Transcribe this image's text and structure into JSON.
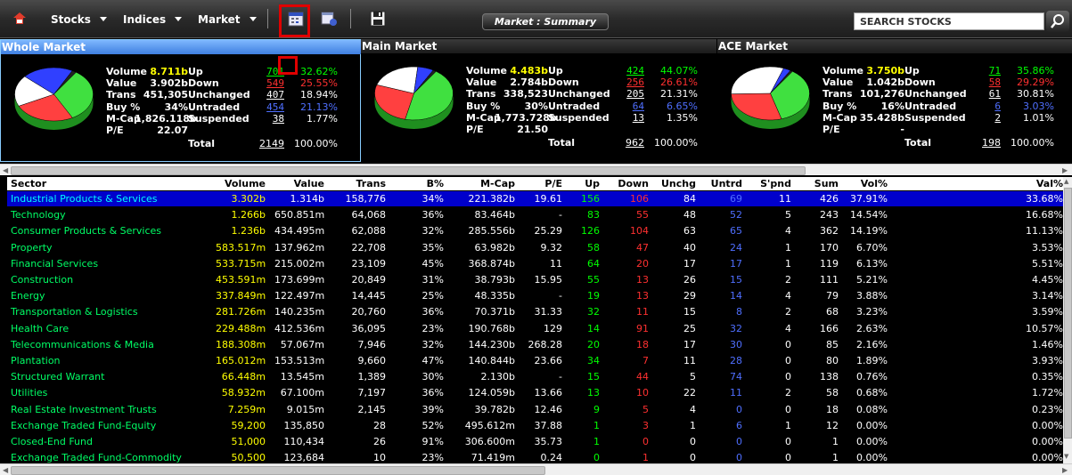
{
  "toolbar": {
    "menus": [
      {
        "label": "Stocks"
      },
      {
        "label": "Indices"
      },
      {
        "label": "Market"
      }
    ],
    "summary_label": "Market : Summary",
    "search_placeholder": "SEARCH STOCKS"
  },
  "panels": [
    {
      "title": "Whole Market",
      "title_color": "#5fa0ff",
      "labels": [
        "Volume",
        "Value",
        "Trans",
        "Buy %",
        "M-Cap",
        "P/E"
      ],
      "values": [
        "8.711b",
        "3.902b",
        "451,305",
        "34%",
        "1,826.118b",
        "22.07"
      ],
      "counts": [
        {
          "label": "Up",
          "count": "701",
          "pct": "32.62%"
        },
        {
          "label": "Down",
          "count": "549",
          "pct": "25.55%"
        },
        {
          "label": "Unchanged",
          "count": "407",
          "pct": "18.94%"
        },
        {
          "label": "Untraded",
          "count": "454",
          "pct": "21.13%"
        },
        {
          "label": "Suspended",
          "count": "38",
          "pct": "1.77%"
        }
      ],
      "total_label": "Total",
      "total_count": "2149",
      "total_pct": "100.00%",
      "pie": [
        32.62,
        25.55,
        18.94,
        21.13,
        1.77
      ]
    },
    {
      "title": "Main Market",
      "title_color": "#2a2a2a",
      "labels": [
        "Volume",
        "Value",
        "Trans",
        "Buy %",
        "M-Cap",
        "P/E"
      ],
      "values": [
        "4.483b",
        "2.784b",
        "338,523",
        "30%",
        "1,773.728b",
        "21.50"
      ],
      "counts": [
        {
          "label": "Up",
          "count": "424",
          "pct": "44.07%"
        },
        {
          "label": "Down",
          "count": "256",
          "pct": "26.61%"
        },
        {
          "label": "Unchanged",
          "count": "205",
          "pct": "21.31%"
        },
        {
          "label": "Untraded",
          "count": "64",
          "pct": "6.65%"
        },
        {
          "label": "Suspended",
          "count": "13",
          "pct": "1.35%"
        }
      ],
      "total_label": "Total",
      "total_count": "962",
      "total_pct": "100.00%",
      "pie": [
        44.07,
        26.61,
        21.31,
        6.65,
        1.35
      ]
    },
    {
      "title": "ACE Market",
      "title_color": "#2a2a2a",
      "labels": [
        "Volume",
        "Value",
        "Trans",
        "Buy %",
        "M-Cap",
        "P/E"
      ],
      "values": [
        "3.750b",
        "1.042b",
        "101,276",
        "16%",
        "35.428b",
        "-"
      ],
      "counts": [
        {
          "label": "Up",
          "count": "71",
          "pct": "35.86%"
        },
        {
          "label": "Down",
          "count": "58",
          "pct": "29.29%"
        },
        {
          "label": "Unchanged",
          "count": "61",
          "pct": "30.81%"
        },
        {
          "label": "Untraded",
          "count": "6",
          "pct": "3.03%"
        },
        {
          "label": "Suspended",
          "count": "2",
          "pct": "1.01%"
        }
      ],
      "total_label": "Total",
      "total_count": "198",
      "total_pct": "100.00%",
      "pie": [
        35.86,
        29.29,
        30.81,
        3.03,
        1.01
      ]
    }
  ],
  "table": {
    "headers": [
      "Sector",
      "Volume",
      "Value",
      "Trans",
      "B%",
      "M-Cap",
      "P/E",
      "Up",
      "Down",
      "Unchg",
      "Untrd",
      "S'pnd",
      "Sum",
      "Vol%",
      "Val%"
    ],
    "rows": [
      [
        "Industrial Products & Services",
        "3.302b",
        "1.314b",
        "158,776",
        "34%",
        "221.382b",
        "19.61",
        "156",
        "106",
        "84",
        "69",
        "11",
        "426",
        "37.91%",
        "33.68%"
      ],
      [
        "Technology",
        "1.266b",
        "650.851m",
        "64,068",
        "36%",
        "83.464b",
        "-",
        "83",
        "55",
        "48",
        "52",
        "5",
        "243",
        "14.54%",
        "16.68%"
      ],
      [
        "Consumer Products & Services",
        "1.236b",
        "434.495m",
        "62,088",
        "32%",
        "285.556b",
        "25.29",
        "126",
        "104",
        "63",
        "65",
        "4",
        "362",
        "14.19%",
        "11.13%"
      ],
      [
        "Property",
        "583.517m",
        "137.962m",
        "22,708",
        "35%",
        "63.982b",
        "9.32",
        "58",
        "47",
        "40",
        "24",
        "1",
        "170",
        "6.70%",
        "3.53%"
      ],
      [
        "Financial Services",
        "533.715m",
        "215.002m",
        "23,109",
        "45%",
        "368.874b",
        "11",
        "64",
        "20",
        "17",
        "17",
        "1",
        "119",
        "6.13%",
        "5.51%"
      ],
      [
        "Construction",
        "453.591m",
        "173.699m",
        "20,849",
        "31%",
        "38.793b",
        "15.95",
        "55",
        "13",
        "26",
        "15",
        "2",
        "111",
        "5.21%",
        "4.45%"
      ],
      [
        "Energy",
        "337.849m",
        "122.497m",
        "14,445",
        "25%",
        "48.335b",
        "-",
        "19",
        "13",
        "29",
        "14",
        "4",
        "79",
        "3.88%",
        "3.14%"
      ],
      [
        "Transportation & Logistics",
        "281.726m",
        "140.235m",
        "20,760",
        "36%",
        "70.371b",
        "31.33",
        "32",
        "11",
        "15",
        "8",
        "2",
        "68",
        "3.23%",
        "3.59%"
      ],
      [
        "Health Care",
        "229.488m",
        "412.536m",
        "36,095",
        "23%",
        "190.768b",
        "129",
        "14",
        "91",
        "25",
        "32",
        "4",
        "166",
        "2.63%",
        "10.57%"
      ],
      [
        "Telecommunications & Media",
        "188.308m",
        "57.067m",
        "7,946",
        "32%",
        "144.230b",
        "268.28",
        "20",
        "18",
        "17",
        "30",
        "0",
        "85",
        "2.16%",
        "1.46%"
      ],
      [
        "Plantation",
        "165.012m",
        "153.513m",
        "9,660",
        "47%",
        "140.844b",
        "23.66",
        "34",
        "7",
        "11",
        "28",
        "0",
        "80",
        "1.89%",
        "3.93%"
      ],
      [
        "Structured Warrant",
        "66.448m",
        "13.545m",
        "1,389",
        "30%",
        "2.130b",
        "-",
        "15",
        "44",
        "5",
        "74",
        "0",
        "138",
        "0.76%",
        "0.35%"
      ],
      [
        "Utilities",
        "58.932m",
        "67.100m",
        "7,197",
        "36%",
        "124.059b",
        "13.66",
        "13",
        "10",
        "22",
        "11",
        "2",
        "58",
        "0.68%",
        "1.72%"
      ],
      [
        "Real Estate Investment Trusts",
        "7.259m",
        "9.015m",
        "2,145",
        "39%",
        "39.782b",
        "12.46",
        "9",
        "5",
        "4",
        "0",
        "0",
        "18",
        "0.08%",
        "0.23%"
      ],
      [
        "Exchange Traded Fund-Equity",
        "59,200",
        "135,850",
        "28",
        "52%",
        "495.612m",
        "37.88",
        "1",
        "3",
        "1",
        "6",
        "1",
        "12",
        "0.00%",
        "0.00%"
      ],
      [
        "Closed-End Fund",
        "51,000",
        "110,434",
        "26",
        "91%",
        "306.600m",
        "35.73",
        "1",
        "0",
        "0",
        "0",
        "0",
        "1",
        "0.00%",
        "0.00%"
      ],
      [
        "Exchange Traded Fund-Commodity",
        "50,500",
        "123,684",
        "10",
        "23%",
        "71.419m",
        "0.24",
        "0",
        "1",
        "0",
        "0",
        "0",
        "1",
        "0.00%",
        "0.00%"
      ]
    ]
  },
  "colors": {
    "up": "#00ff00",
    "down": "#ff3030",
    "untraded": "#4f6fff",
    "sector": "#00ff66",
    "volume": "#ffff00",
    "selected_row": "#0000cc"
  }
}
